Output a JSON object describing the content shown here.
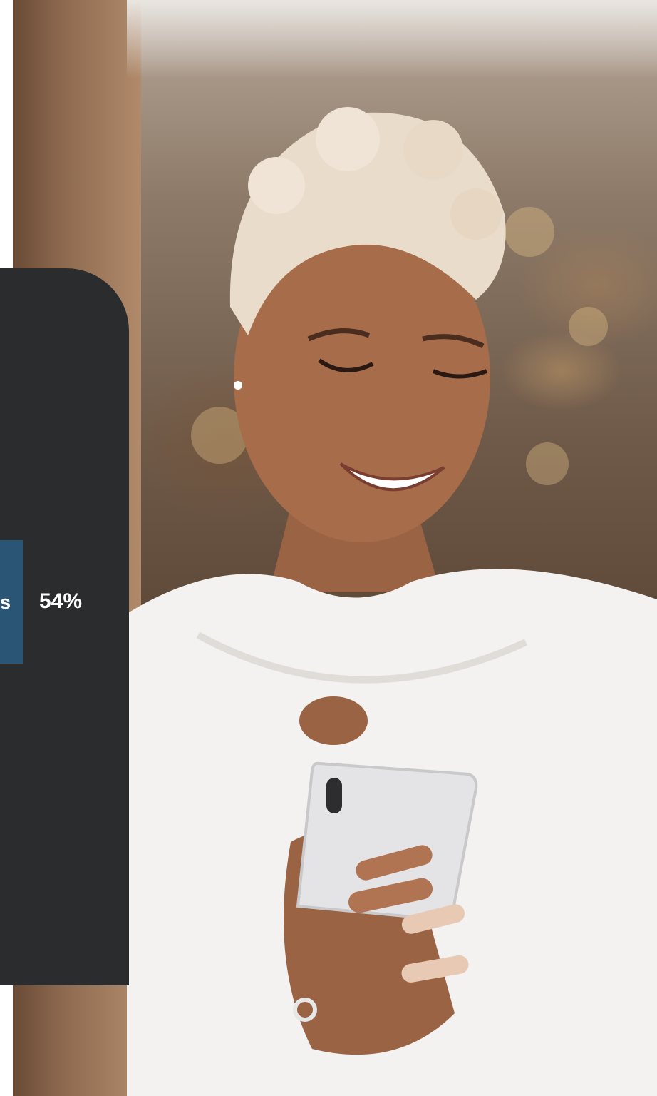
{
  "stat": {
    "label": "s",
    "value": "54%"
  },
  "colors": {
    "panel": "#2b2c2e",
    "bar": "#2b5575",
    "text": "#ffffff"
  }
}
